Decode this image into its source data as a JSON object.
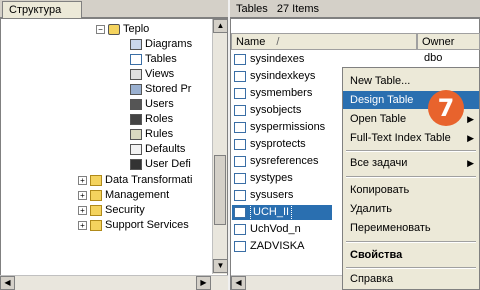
{
  "left": {
    "tab_label": "Структура",
    "tree": [
      {
        "label": "Teplo",
        "icon": "database-icon"
      },
      {
        "label": "Diagrams",
        "icon": "diagram-icon"
      },
      {
        "label": "Tables",
        "icon": "table-icon"
      },
      {
        "label": "Views",
        "icon": "view-icon"
      },
      {
        "label": "Stored Pr",
        "icon": "stored-procedure-icon"
      },
      {
        "label": "Users",
        "icon": "users-icon"
      },
      {
        "label": "Roles",
        "icon": "roles-icon"
      },
      {
        "label": "Rules",
        "icon": "rules-icon"
      },
      {
        "label": "Defaults",
        "icon": "defaults-icon"
      },
      {
        "label": "User Defi",
        "icon": "user-defined-icon"
      },
      {
        "label": "Data Transformati",
        "icon": "folder-icon"
      },
      {
        "label": "Management",
        "icon": "folder-icon"
      },
      {
        "label": "Security",
        "icon": "folder-icon"
      },
      {
        "label": "Support Services",
        "icon": "folder-icon"
      }
    ]
  },
  "right": {
    "title": "Tables",
    "count": "27 Items",
    "columns": {
      "name": "Name",
      "owner": "Owner"
    },
    "rows": [
      "sysindexes",
      "sysindexkeys",
      "sysmembers",
      "sysobjects",
      "syspermissions",
      "sysprotects",
      "sysreferences",
      "systypes",
      "sysusers",
      "UCH_II",
      "UchVod_n",
      "ZADVISKA"
    ],
    "first_row_owner": "dbo",
    "selected_row": "UCH_II"
  },
  "context_menu": {
    "items": [
      {
        "label": "New Table...",
        "submenu": false
      },
      {
        "label": "Design Table",
        "submenu": false,
        "highlighted": true
      },
      {
        "label": "Open Table",
        "submenu": true
      },
      {
        "label": "Full-Text Index Table",
        "submenu": true
      },
      {
        "label": "Все задачи",
        "submenu": true
      },
      {
        "label": "Копировать",
        "submenu": false
      },
      {
        "label": "Удалить",
        "submenu": false
      },
      {
        "label": "Переименовать",
        "submenu": false
      },
      {
        "label": "Свойства",
        "submenu": false,
        "bold": true
      },
      {
        "label": "Справка",
        "submenu": false
      }
    ]
  },
  "step_badge": "7",
  "colors": {
    "selection": "#2a6fb0",
    "badge": "#e8632d"
  }
}
